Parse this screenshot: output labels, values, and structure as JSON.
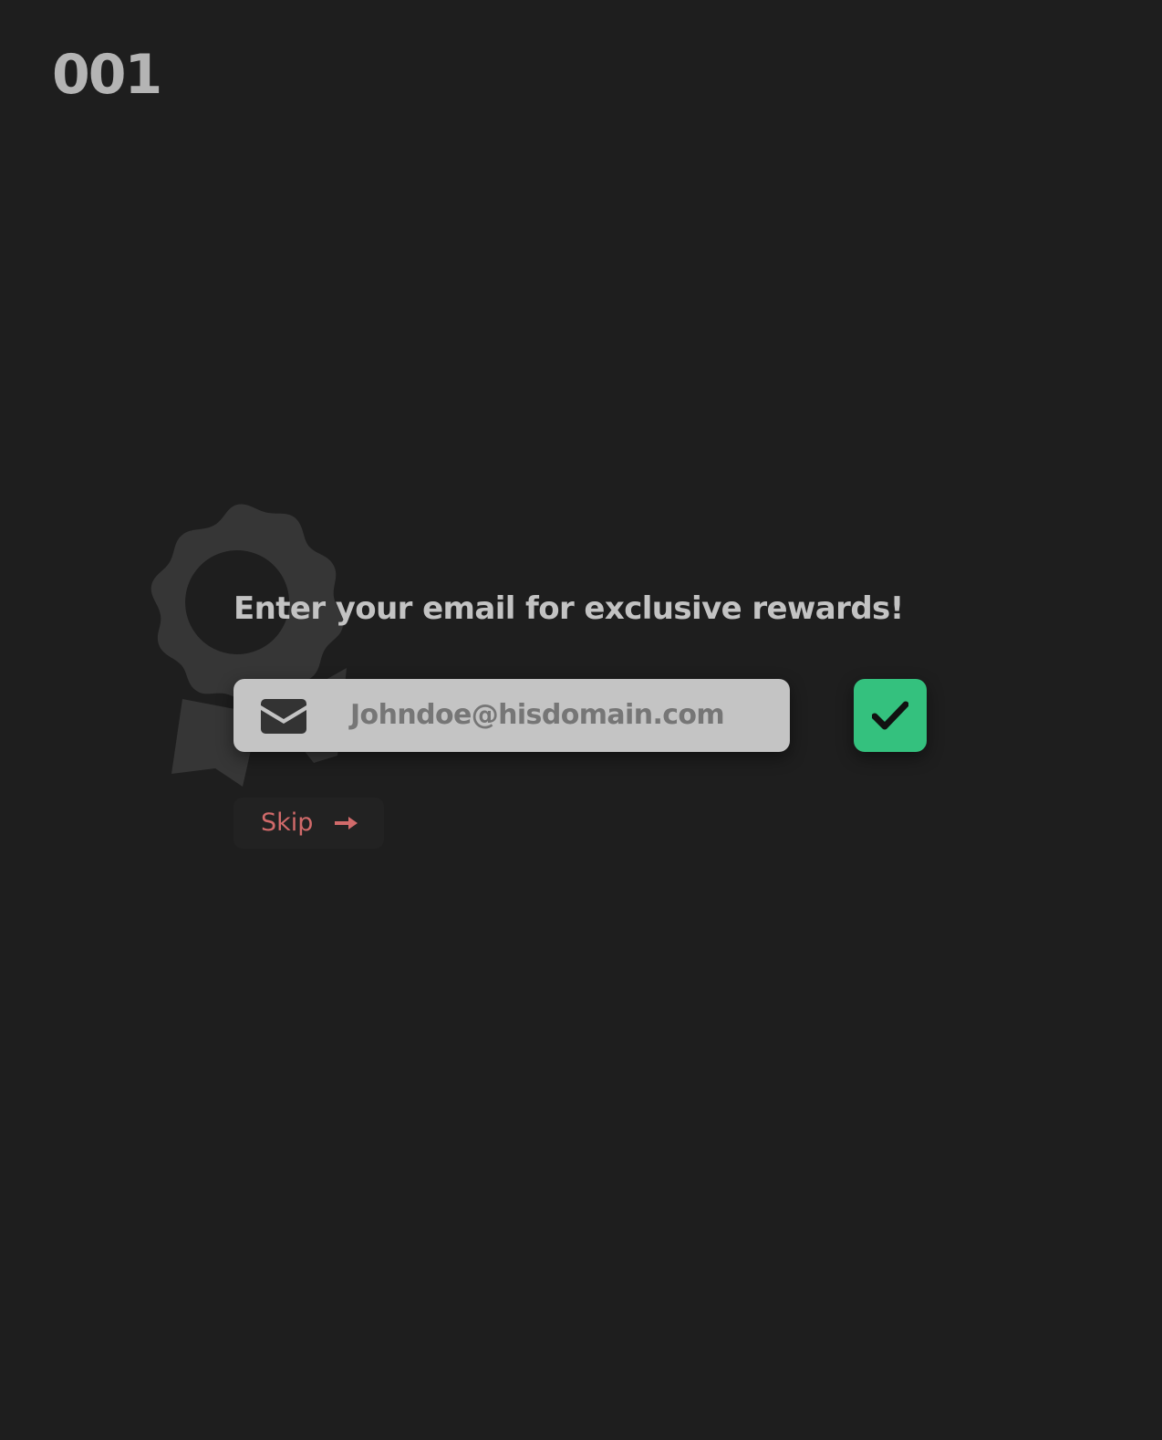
{
  "page": {
    "number": "001"
  },
  "prompt": {
    "heading": "Enter your email for exclusive rewards!",
    "email_value": "Johndoe@hisdomain.com",
    "skip_label": "Skip"
  },
  "icons": {
    "badge": "award-ribbon-icon",
    "mail": "envelope-icon",
    "submit": "checkmark-icon",
    "skip": "arrow-right-icon"
  },
  "colors": {
    "background": "#1e1e1e",
    "accent_green": "#34c17e",
    "skip_text": "#d16a6a",
    "field_background": "#c4c4c4"
  }
}
